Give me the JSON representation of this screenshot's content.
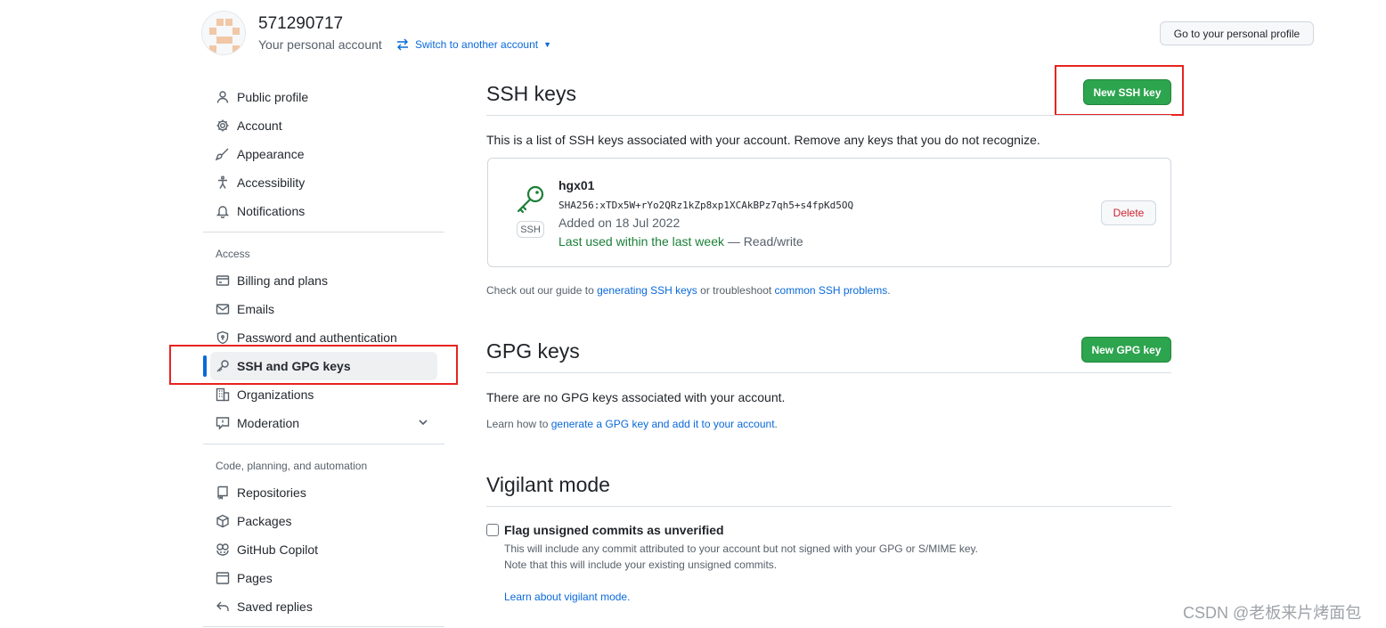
{
  "header": {
    "username": "571290717",
    "account_type": "Your personal account",
    "switch_label": "Switch to another account",
    "go_profile_label": "Go to your personal profile"
  },
  "sidebar": {
    "items_top": [
      {
        "label": "Public profile",
        "icon": "person-icon"
      },
      {
        "label": "Account",
        "icon": "gear-icon"
      },
      {
        "label": "Appearance",
        "icon": "paintbrush-icon"
      },
      {
        "label": "Accessibility",
        "icon": "accessibility-icon"
      },
      {
        "label": "Notifications",
        "icon": "bell-icon"
      }
    ],
    "access_heading": "Access",
    "items_access": [
      {
        "label": "Billing and plans",
        "icon": "credit-card-icon"
      },
      {
        "label": "Emails",
        "icon": "mail-icon"
      },
      {
        "label": "Password and authentication",
        "icon": "shield-lock-icon"
      },
      {
        "label": "SSH and GPG keys",
        "icon": "key-icon",
        "active": true
      },
      {
        "label": "Organizations",
        "icon": "organization-icon"
      },
      {
        "label": "Moderation",
        "icon": "report-icon"
      }
    ],
    "code_heading": "Code, planning, and automation",
    "items_code": [
      {
        "label": "Repositories",
        "icon": "repo-icon"
      },
      {
        "label": "Packages",
        "icon": "package-icon"
      },
      {
        "label": "GitHub Copilot",
        "icon": "copilot-icon"
      },
      {
        "label": "Pages",
        "icon": "browser-icon"
      },
      {
        "label": "Saved replies",
        "icon": "reply-icon"
      }
    ]
  },
  "ssh": {
    "title": "SSH keys",
    "new_button": "New SSH key",
    "description": "This is a list of SSH keys associated with your account. Remove any keys that you do not recognize.",
    "keys": [
      {
        "name": "hgx01",
        "fingerprint": "SHA256:xTDx5W+rYo2QRz1kZp8xp1XCAkBPz7qh5+s4fpKd5OQ",
        "added": "Added on 18 Jul 2022",
        "last_used": "Last used within the last week",
        "access": " — Read/write",
        "tag": "SSH",
        "delete_label": "Delete"
      }
    ],
    "guide_prefix": "Check out our guide to ",
    "guide_link1": "generating SSH keys",
    "guide_middle": " or troubleshoot ",
    "guide_link2": "common SSH problems",
    "guide_suffix": "."
  },
  "gpg": {
    "title": "GPG keys",
    "new_button": "New GPG key",
    "empty": "There are no GPG keys associated with your account.",
    "learn_prefix": "Learn how to ",
    "learn_link": "generate a GPG key and add it to your account",
    "learn_suffix": "."
  },
  "vigilant": {
    "title": "Vigilant mode",
    "checkbox_label": "Flag unsigned commits as unverified",
    "checked": false,
    "note1": "This will include any commit attributed to your account but not signed with your GPG or S/MIME key.",
    "note2": "Note that this will include your existing unsigned commits.",
    "learn_link": "Learn about vigilant mode."
  },
  "watermark": "CSDN @老板来片烤面包",
  "colors": {
    "link": "#0969da",
    "green_button": "#2da44e",
    "active_bar": "#0969da",
    "highlight": "#e8231f",
    "danger": "#cf222e"
  }
}
